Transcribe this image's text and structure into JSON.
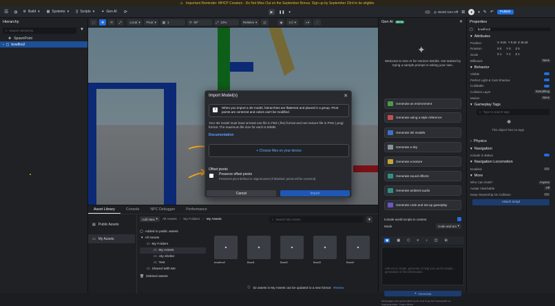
{
  "banner": {
    "text": "Important Reminder: MHCP Creators - Do Not Miss Out on the September Bonus. Sign up by September 23rd to be eligible."
  },
  "topbar": {
    "build": "Build",
    "systems": "Systems",
    "scripts": "Scripts",
    "genai": "Gen AI",
    "world_gen": "World Gen Off",
    "publish": "Publish"
  },
  "hierarchy": {
    "title": "Hierarchy",
    "search_placeholder": "Search Hierarchy",
    "items": [
      "SpawnPoint",
      "bowlfoo2"
    ]
  },
  "view_toolbar": {
    "local": "Local",
    "pivot": "Pivot",
    "snap_move": "1",
    "snap_rotate": "90°",
    "snap_scale": "10%",
    "relative": "Relative",
    "speed": "1.0"
  },
  "modal": {
    "title": "Import Model(s)",
    "info": "When you import a 3D model, hierarchies are flattened and placed in a group. Pivot points are centered and colors can't be modified.",
    "description": "Your 3D model must have at least one file in FBX (.fbx) format and one texture file in PNG (.png) format. The maximum file size for each is 50MB.",
    "doc_link": "Documentation",
    "drop_label": "+ Choose files on your device",
    "pivot_title": "Offset pivots",
    "pivot_label": "Preserve offset pivots",
    "pivot_help": "Preserves pivot defined in original asset (if disabled, pivots will be centered)",
    "cancel": "Cancel",
    "import": "Import"
  },
  "asset_panel": {
    "tabs": [
      "Asset Library",
      "Console",
      "NPC Debugger",
      "Performance"
    ],
    "sidebar": [
      "Public Assets",
      "My Assets"
    ],
    "add_new": "Add New",
    "breadcrumb": [
      "All Assets",
      "My Folders",
      "My Assets"
    ],
    "search_placeholder": "Search My Assets",
    "folders": [
      "Added to public assets",
      "All Assets",
      "My Folders",
      "My Assets",
      "city shelter",
      "Test",
      "Shared With Me",
      "Deleted assets"
    ],
    "tiles": [
      "bowlfoo2",
      "Bowl1",
      "Bowl2",
      "Bowl3",
      "Bowl4"
    ],
    "footer": "52 assets in My Assets can be updated to a new format",
    "review": "Review"
  },
  "genai": {
    "title": "Gen AI",
    "beta": "BETA",
    "welcome": "Welcome to Gen AI for Horizon Worlds. Get started by trying a sample prompt or writing your own.",
    "buttons": [
      "Generate an environment",
      "Generate using a style reference",
      "Generate 3D models",
      "Generate a sky",
      "Generate a texture",
      "Generate sound effects",
      "Generate ambient audio",
      "Generate code and set up gameplay"
    ],
    "buttons_colors": [
      "#4a9a4a",
      "#c24f4f",
      "#3f6fc9",
      "#8a8f98",
      "#c8a137",
      "#2f8f86",
      "#2f8f86",
      "#6c56c4"
    ],
    "include_scripts": "Include world scripts in context",
    "mode_label": "Mode",
    "mode_value": "Code and act",
    "input_placeholder": "Ask me to create, generate or help you out for scripts, generation or find information.",
    "generate": "Generate",
    "footer_note": "Messages are generated by AI and may be inaccurate or inappropriate. Learn More"
  },
  "properties": {
    "title": "Properties",
    "name": "bowlfoo2",
    "attributes": "Attributes",
    "transform": [
      {
        "label": "Position",
        "x": "-6.01",
        "y": "0.16",
        "z": "15.18"
      },
      {
        "label": "Rotation",
        "x": "0",
        "y": "0",
        "z": "0"
      },
      {
        "label": "Scale",
        "x": "1",
        "y": "1",
        "z": "1"
      }
    ],
    "billboard": {
      "label": "Billboard",
      "value": "None"
    },
    "behavior": "Behavior",
    "behavior_rows": [
      "Visible",
      "Perfect Light & Cast Shadow",
      "Collidable"
    ],
    "collision_layer": {
      "label": "Collision Layer",
      "value": "Everything"
    },
    "motion": {
      "label": "Motion",
      "value": "None"
    },
    "gameplay_tags": "Gameplay Tags",
    "tags_placeholder": "Type to search tags",
    "no_tags": "This object has no tags",
    "physics": "Physics",
    "navigation": "Navigation",
    "include_bakes": "Include in Bakes",
    "nav_loco": "Navigation Locomotion",
    "enabled": "Enabled",
    "more": "More",
    "who_can_grab": {
      "label": "Who Can Grab?",
      "value": "Anyone"
    },
    "avatar_attachable": {
      "label": "Avatar Attachable",
      "value": "Off"
    },
    "keep_ownership": "Keep Ownership On Collision",
    "attach_script": "Attach script"
  }
}
